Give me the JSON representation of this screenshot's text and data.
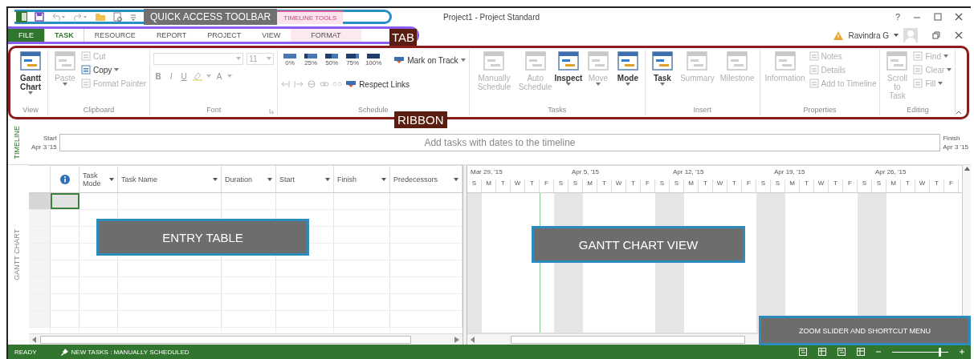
{
  "title_bar": {
    "callout": "QUICK ACCESS TOOLBAR",
    "contextual_group": "TIMELINE TOOLS",
    "title": "Project1 - Project Standard",
    "help": "?"
  },
  "tabs": [
    {
      "label": "FILE",
      "kind": "file",
      "selected": false
    },
    {
      "label": "TASK",
      "kind": "normal",
      "selected": true
    },
    {
      "label": "RESOURCE",
      "kind": "normal",
      "selected": false
    },
    {
      "label": "REPORT",
      "kind": "normal",
      "selected": false
    },
    {
      "label": "PROJECT",
      "kind": "normal",
      "selected": false
    },
    {
      "label": "VIEW",
      "kind": "normal",
      "selected": false
    },
    {
      "label": "FORMAT",
      "kind": "contextual",
      "selected": false
    }
  ],
  "tab_callout": "TAB",
  "account": {
    "name": "Ravindra G"
  },
  "ribbon": {
    "callout": "RIBBON",
    "groups": [
      {
        "label": "View",
        "kind": "buttons",
        "items": [
          {
            "label": "Gantt Chart",
            "kind": "large",
            "disabled": false,
            "dropdown": true
          }
        ]
      },
      {
        "label": "Clipboard",
        "kind": "buttons",
        "items": [
          {
            "label": "Paste",
            "kind": "large",
            "disabled": true,
            "dropdown": true
          },
          {
            "label": "Cut",
            "kind": "small",
            "disabled": true,
            "dropdown": false
          },
          {
            "label": "Copy",
            "kind": "small",
            "disabled": false,
            "dropdown": true
          },
          {
            "label": "Format Painter",
            "kind": "small",
            "disabled": true,
            "dropdown": false
          }
        ]
      },
      {
        "label": "Font",
        "kind": "font",
        "size": "11",
        "styles": [
          "B",
          "I",
          "U"
        ],
        "color_letter": "A"
      },
      {
        "label": "Schedule",
        "kind": "schedule",
        "percents": [
          "0%",
          "25%",
          "50%",
          "75%",
          "100%"
        ],
        "items": [
          {
            "label": "Mark on Track",
            "kind": "small",
            "disabled": false,
            "dropdown": true
          },
          {
            "label": "Respect Links",
            "kind": "small",
            "disabled": false,
            "dropdown": false
          }
        ]
      },
      {
        "label": "Tasks",
        "kind": "buttons",
        "items": [
          {
            "label": "Manually Schedule",
            "kind": "large",
            "disabled": true,
            "dropdown": false
          },
          {
            "label": "Auto Schedule",
            "kind": "large",
            "disabled": true,
            "dropdown": false
          },
          {
            "label": "Inspect",
            "kind": "large",
            "disabled": false,
            "dropdown": true
          },
          {
            "label": "Move",
            "kind": "large",
            "disabled": true,
            "dropdown": true
          },
          {
            "label": "Mode",
            "kind": "large",
            "disabled": false,
            "dropdown": true
          }
        ]
      },
      {
        "label": "Insert",
        "kind": "buttons",
        "items": [
          {
            "label": "Task",
            "kind": "large",
            "disabled": false,
            "dropdown": true
          },
          {
            "label": "Summary",
            "kind": "large",
            "disabled": true,
            "dropdown": false
          },
          {
            "label": "Milestone",
            "kind": "large",
            "disabled": true,
            "dropdown": false
          }
        ]
      },
      {
        "label": "Properties",
        "kind": "buttons",
        "items": [
          {
            "label": "Information",
            "kind": "large",
            "disabled": true,
            "dropdown": false
          },
          {
            "label": "Notes",
            "kind": "small",
            "disabled": true,
            "dropdown": false
          },
          {
            "label": "Details",
            "kind": "small",
            "disabled": true,
            "dropdown": false
          },
          {
            "label": "Add to Timeline",
            "kind": "small",
            "disabled": true,
            "dropdown": false
          }
        ]
      },
      {
        "label": "Editing",
        "kind": "buttons",
        "items": [
          {
            "label": "Scroll to Task",
            "kind": "large",
            "disabled": true,
            "dropdown": false
          },
          {
            "label": "Find",
            "kind": "small",
            "disabled": true,
            "dropdown": true
          },
          {
            "label": "Clear",
            "kind": "small",
            "disabled": true,
            "dropdown": true
          },
          {
            "label": "Fill",
            "kind": "small",
            "disabled": true,
            "dropdown": true
          }
        ]
      }
    ]
  },
  "timeline": {
    "side_label": "TIMELINE",
    "start_label": "Start",
    "start_date": "Apr 3 '15",
    "prompt": "Add tasks with dates to the timeline",
    "finish_label": "Finish",
    "finish_date": "Apr 3 '15"
  },
  "view": {
    "side_label": "GANTT CHART",
    "entry_callout": "ENTRY TABLE",
    "chart_callout": "GANTT CHART VIEW",
    "zoom_callout": "ZOOM SLIDER AND SHORTCUT MENU",
    "columns": [
      {
        "kind": "info"
      },
      {
        "kind": "text",
        "label": "Task Mode"
      },
      {
        "kind": "text",
        "label": "Task Name"
      },
      {
        "kind": "text",
        "label": "Duration"
      },
      {
        "kind": "text",
        "label": "Start"
      },
      {
        "kind": "text",
        "label": "Finish"
      },
      {
        "kind": "text",
        "label": "Predecessors"
      }
    ],
    "rows": [
      {
        "selected": true
      },
      {
        "selected": false
      },
      {
        "selected": false
      },
      {
        "selected": false
      },
      {
        "selected": false
      },
      {
        "selected": false
      },
      {
        "selected": false
      },
      {
        "selected": false
      }
    ],
    "weeks": [
      {
        "label": "Mar 29, '15",
        "days": [
          {
            "label": "S",
            "shaded": true,
            "today": false
          },
          {
            "label": "M",
            "shaded": false,
            "today": false
          },
          {
            "label": "T",
            "shaded": false,
            "today": false
          },
          {
            "label": "W",
            "shaded": false,
            "today": false
          },
          {
            "label": "T",
            "shaded": false,
            "today": false
          },
          {
            "label": "F",
            "shaded": false,
            "today": true
          },
          {
            "label": "S",
            "shaded": true,
            "today": false
          }
        ]
      },
      {
        "label": "Apr 5, '15",
        "days": [
          {
            "label": "S",
            "shaded": true,
            "today": false
          },
          {
            "label": "M",
            "shaded": false,
            "today": false
          },
          {
            "label": "T",
            "shaded": false,
            "today": false
          },
          {
            "label": "W",
            "shaded": false,
            "today": false
          },
          {
            "label": "T",
            "shaded": false,
            "today": false
          },
          {
            "label": "F",
            "shaded": false,
            "today": false
          },
          {
            "label": "S",
            "shaded": true,
            "today": false
          }
        ]
      },
      {
        "label": "Apr 12, '15",
        "days": [
          {
            "label": "S",
            "shaded": true,
            "today": false
          },
          {
            "label": "M",
            "shaded": false,
            "today": false
          },
          {
            "label": "T",
            "shaded": false,
            "today": false
          },
          {
            "label": "W",
            "shaded": false,
            "today": false
          },
          {
            "label": "T",
            "shaded": false,
            "today": false
          },
          {
            "label": "F",
            "shaded": false,
            "today": false
          },
          {
            "label": "S",
            "shaded": true,
            "today": false
          }
        ]
      },
      {
        "label": "Apr 19, '15",
        "days": [
          {
            "label": "S",
            "shaded": true,
            "today": false
          },
          {
            "label": "M",
            "shaded": false,
            "today": false
          },
          {
            "label": "T",
            "shaded": false,
            "today": false
          },
          {
            "label": "W",
            "shaded": false,
            "today": false
          },
          {
            "label": "T",
            "shaded": false,
            "today": false
          },
          {
            "label": "F",
            "shaded": false,
            "today": false
          },
          {
            "label": "S",
            "shaded": true,
            "today": false
          }
        ]
      },
      {
        "label": "Apr 26, '15",
        "days": [
          {
            "label": "S",
            "shaded": true,
            "today": false
          },
          {
            "label": "M",
            "shaded": false,
            "today": false
          },
          {
            "label": "T",
            "shaded": false,
            "today": false
          },
          {
            "label": "W",
            "shaded": false,
            "today": false
          },
          {
            "label": "T",
            "shaded": false,
            "today": false
          },
          {
            "label": "F",
            "shaded": false,
            "today": false
          }
        ]
      }
    ]
  },
  "status_bar": {
    "mode": "READY",
    "new_tasks": "NEW TASKS : MANUALLY SCHEDULED",
    "zoom": {
      "level": 0.85
    }
  }
}
